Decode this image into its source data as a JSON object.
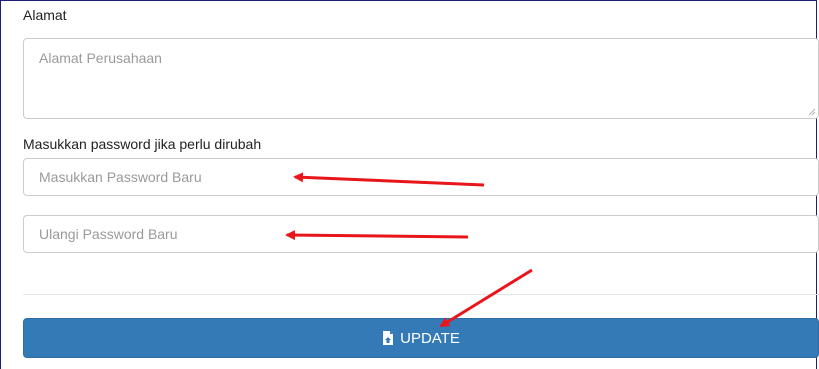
{
  "form": {
    "alamat_label": "Alamat",
    "alamat_placeholder": "Alamat Perusahaan",
    "password_section_label": "Masukkan password jika perlu dirubah",
    "new_password_placeholder": "Masukkan Password Baru",
    "repeat_password_placeholder": "Ulangi Password Baru",
    "update_button_label": "UPDATE",
    "update_button_icon": "save-file-icon"
  },
  "annotations": {
    "arrow_color": "#e8161b"
  },
  "colors": {
    "primary_button": "#337ab7",
    "border": "#cccccc",
    "placeholder": "#9a9a9a"
  }
}
